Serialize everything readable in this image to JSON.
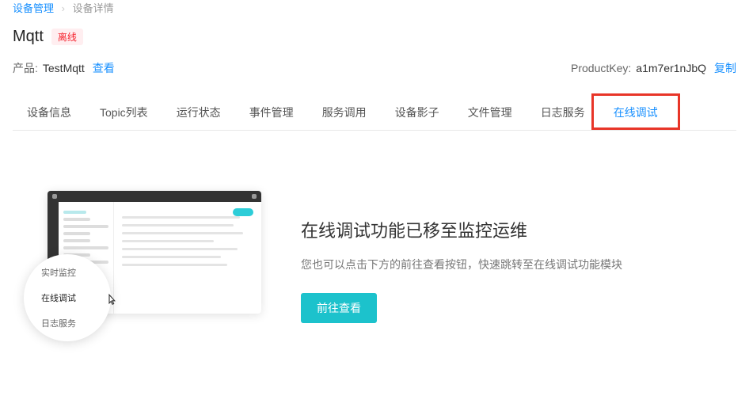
{
  "breadcrumb": {
    "parent": "设备管理",
    "current": "设备详情"
  },
  "header": {
    "device_name": "Mqtt",
    "status_label": "离线",
    "product_label": "产品:",
    "product_name": "TestMqtt",
    "view_link": "查看",
    "productkey_label": "ProductKey:",
    "productkey_value": "a1m7er1nJbQ",
    "copy_link": "复制"
  },
  "tabs": [
    {
      "label": "设备信息"
    },
    {
      "label": "Topic列表"
    },
    {
      "label": "运行状态"
    },
    {
      "label": "事件管理"
    },
    {
      "label": "服务调用"
    },
    {
      "label": "设备影子"
    },
    {
      "label": "文件管理"
    },
    {
      "label": "日志服务"
    },
    {
      "label": "在线调试",
      "active": true
    }
  ],
  "popup": {
    "opt1": "实时监控",
    "opt2": "在线调试",
    "opt3": "日志服务"
  },
  "panel": {
    "title": "在线调试功能已移至监控运维",
    "description": "您也可以点击下方的前往查看按钮，快速跳转至在线调试功能模块",
    "button_label": "前往查看"
  }
}
